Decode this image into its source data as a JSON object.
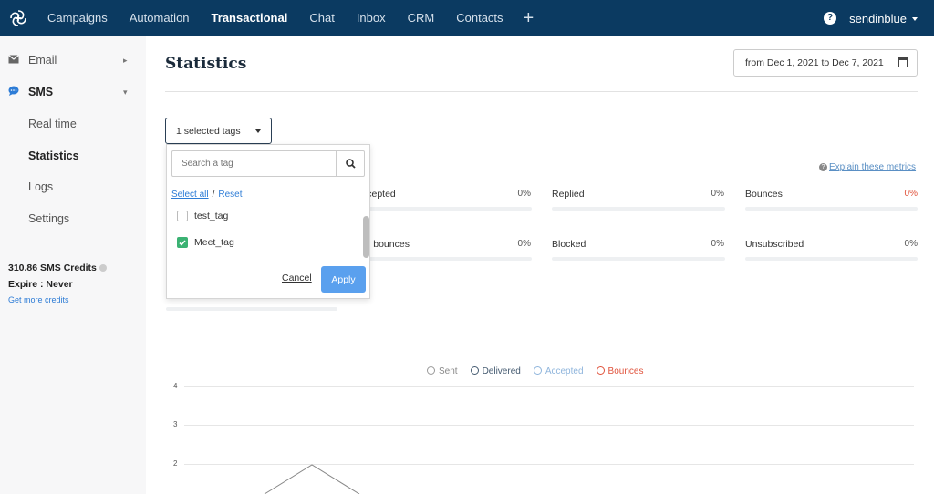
{
  "topbar": {
    "nav": [
      {
        "label": "Campaigns",
        "active": false
      },
      {
        "label": "Automation",
        "active": false
      },
      {
        "label": "Transactional",
        "active": true
      },
      {
        "label": "Chat",
        "active": false
      },
      {
        "label": "Inbox",
        "active": false
      },
      {
        "label": "CRM",
        "active": false
      },
      {
        "label": "Contacts",
        "active": false
      }
    ],
    "plus": "+",
    "help_glyph": "?",
    "account": "sendinblue",
    "bg_color": "#0b3a61"
  },
  "sidebar": {
    "items": [
      {
        "label": "Email",
        "icon": "envelope-icon",
        "chevron": "▸"
      },
      {
        "label": "SMS",
        "icon": "chat-bubble-icon",
        "chevron": "▾"
      }
    ],
    "sub_items": [
      "Real time",
      "Statistics",
      "Logs",
      "Settings"
    ],
    "active_sub": "Statistics",
    "credits": "310.86 SMS Credits",
    "expire": "Expire : Never",
    "get_more": "Get more credits"
  },
  "main": {
    "title": "Statistics",
    "date_range": "from Dec 1, 2021 to Dec 7, 2021",
    "tags_button": "1 selected tags",
    "explain": "Explain these metrics",
    "metrics": [
      {
        "label": "ccepted",
        "value": "0%"
      },
      {
        "label": "Replied",
        "value": "0%"
      },
      {
        "label": "Bounces",
        "value": "0%"
      },
      {
        "label": "rd bounces",
        "value": "0%"
      },
      {
        "label": "Blocked",
        "value": "0%"
      },
      {
        "label": "Unsubscribed",
        "value": "0%"
      }
    ],
    "accent_bounce": "#e0533c"
  },
  "dropdown": {
    "search_placeholder": "Search a tag",
    "select_all": "Select all",
    "slash": "/",
    "reset": "Reset",
    "options": [
      {
        "label": "test_tag",
        "checked": false
      },
      {
        "label": "Meet_tag",
        "checked": true
      }
    ],
    "cancel": "Cancel",
    "apply": "Apply"
  },
  "chart_data": {
    "type": "line",
    "legend": [
      {
        "name": "Sent",
        "color": "#999999"
      },
      {
        "name": "Delivered",
        "color": "#445a70"
      },
      {
        "name": "Accepted",
        "color": "#8fb5dc"
      },
      {
        "name": "Bounces",
        "color": "#e0533c"
      }
    ],
    "y_ticks": [
      "4",
      "3",
      "2"
    ],
    "ylim": [
      0,
      4
    ],
    "grid": true,
    "legend_position": "top-center"
  }
}
